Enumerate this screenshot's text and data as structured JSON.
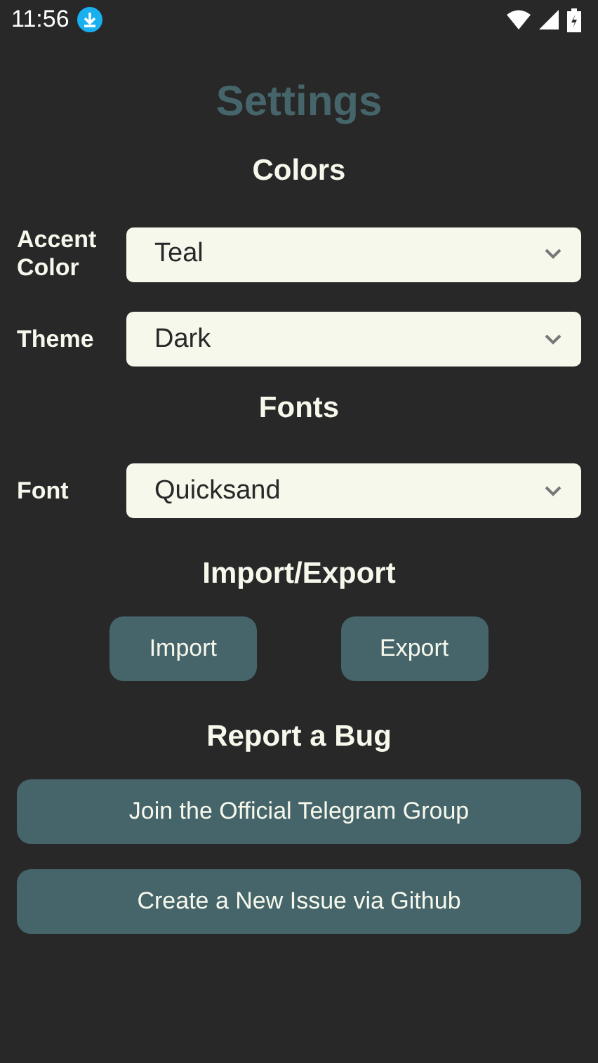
{
  "status_bar": {
    "time": "11:56"
  },
  "title": "Settings",
  "sections": [
    {
      "heading": "Colors",
      "kind": "selects",
      "items": [
        {
          "label": "Accent Color",
          "value": "Teal"
        },
        {
          "label": "Theme",
          "value": "Dark"
        }
      ]
    },
    {
      "heading": "Fonts",
      "kind": "selects",
      "items": [
        {
          "label": "Font",
          "value": "Quicksand"
        }
      ]
    },
    {
      "heading": "Import/Export",
      "kind": "pair",
      "items": [
        {
          "label": "Import"
        },
        {
          "label": "Export"
        }
      ]
    },
    {
      "heading": "Report a Bug",
      "kind": "stack",
      "items": [
        {
          "label": "Join the Official Telegram Group"
        },
        {
          "label": "Create a New Issue via Github"
        }
      ]
    }
  ]
}
